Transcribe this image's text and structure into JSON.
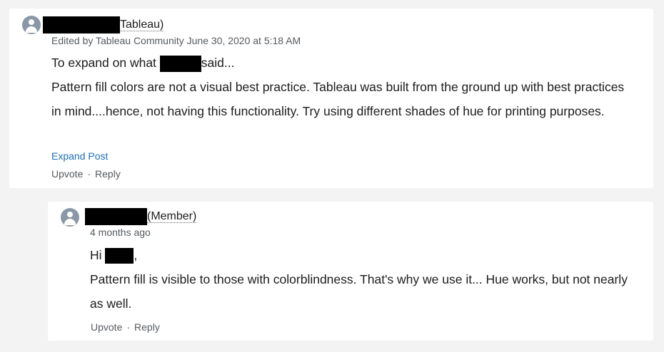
{
  "comments": [
    {
      "author_role": "Tableau)",
      "meta": "Edited by Tableau Community June 30, 2020 at 5:18 AM",
      "line1_before": "To expand on what",
      "line1_after": "said...",
      "paragraph": "Pattern fill colors are not a visual best practice.  Tableau was built from the ground up with best practices in mind....hence, not having this functionality.  Try using different shades of hue for printing purposes.",
      "expand_label": "Expand Post",
      "upvote_label": "Upvote",
      "separator": "·",
      "reply_label": "Reply"
    },
    {
      "author_role": "(Member)",
      "meta": "4 months ago",
      "greeting_before": "Hi",
      "greeting_after": ",",
      "paragraph": "Pattern fill is visible to those with colorblindness. That's why we use it... Hue works, but not nearly as well.",
      "upvote_label": "Upvote",
      "separator": "·",
      "reply_label": "Reply"
    }
  ],
  "colors": {
    "page_background": "#f3f3f3",
    "card_background": "#ffffff",
    "link": "#1f6fb2",
    "avatar": "#8a97a6",
    "redaction": "#000000"
  }
}
